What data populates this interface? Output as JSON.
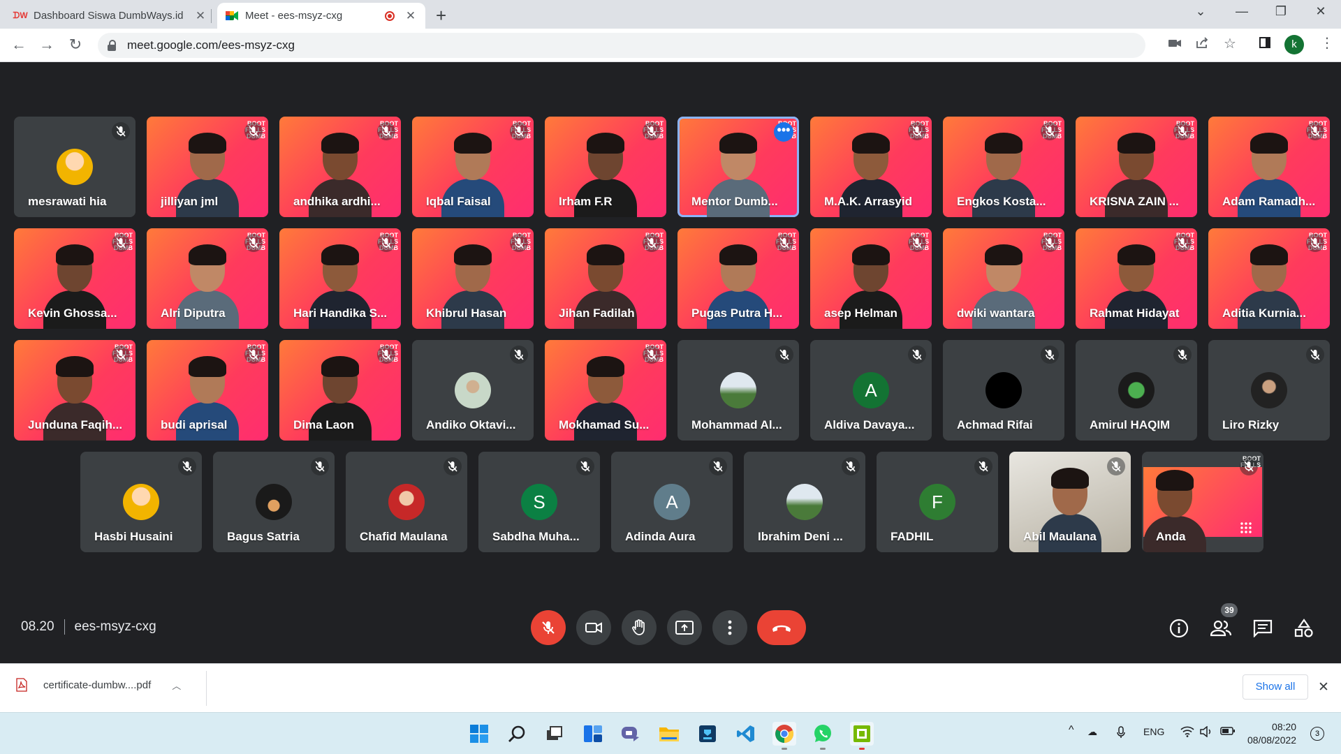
{
  "browser": {
    "tabs": [
      {
        "title": "Dashboard Siswa DumbWays.id",
        "favicon": "dumbways-logo"
      },
      {
        "title": "Meet - ees-msyz-cxg",
        "favicon": "google-meet-logo",
        "recording": true
      }
    ],
    "url": "meet.google.com/ees-msyz-cxg",
    "profile_initial": "k"
  },
  "meet": {
    "participants": [
      {
        "name": "mesrawati hia",
        "type": "avatar"
      },
      {
        "name": "jilliyan jml",
        "type": "video"
      },
      {
        "name": "andhika ardhi...",
        "type": "video"
      },
      {
        "name": "Iqbal Faisal",
        "type": "video"
      },
      {
        "name": "Irham F.R",
        "type": "video"
      },
      {
        "name": "Mentor Dumb...",
        "type": "video",
        "pinned": true
      },
      {
        "name": "M.A.K. Arrasyid",
        "type": "video"
      },
      {
        "name": "Engkos Kosta...",
        "type": "video"
      },
      {
        "name": "KRISNA ZAIN ...",
        "type": "video"
      },
      {
        "name": "Adam Ramadh...",
        "type": "video"
      },
      {
        "name": "Kevin Ghossa...",
        "type": "video"
      },
      {
        "name": "Alri Diputra",
        "type": "video"
      },
      {
        "name": "Hari Handika S...",
        "type": "video"
      },
      {
        "name": "Khibrul Hasan",
        "type": "video"
      },
      {
        "name": "Jihan Fadilah",
        "type": "video"
      },
      {
        "name": "Pugas Putra H...",
        "type": "video"
      },
      {
        "name": "asep Helman",
        "type": "video"
      },
      {
        "name": "dwiki wantara",
        "type": "video"
      },
      {
        "name": "Rahmat Hidayat",
        "type": "video"
      },
      {
        "name": "Aditia Kurnia...",
        "type": "video"
      },
      {
        "name": "Junduna Faqih...",
        "type": "video"
      },
      {
        "name": "budi aprisal",
        "type": "video"
      },
      {
        "name": "Dima Laon",
        "type": "video"
      },
      {
        "name": "Andiko Oktavi...",
        "type": "avatar"
      },
      {
        "name": "Mokhamad Su...",
        "type": "video"
      },
      {
        "name": "Mohammad Al...",
        "type": "avatar"
      },
      {
        "name": "Aldiva Davaya...",
        "type": "letter",
        "letter": "A",
        "color": "#137333"
      },
      {
        "name": "Achmad Rifai",
        "type": "avatar"
      },
      {
        "name": "Amirul HAQIM",
        "type": "avatar"
      },
      {
        "name": "Liro Rizky",
        "type": "avatar"
      },
      {
        "name": "Hasbi Husaini",
        "type": "avatar"
      },
      {
        "name": "Bagus Satria",
        "type": "avatar"
      },
      {
        "name": "Chafid Maulana",
        "type": "avatar"
      },
      {
        "name": "Sabdha Muha...",
        "type": "letter",
        "letter": "S",
        "color": "#0b8043"
      },
      {
        "name": "Adinda Aura",
        "type": "letter",
        "letter": "A",
        "color": "#607d8b"
      },
      {
        "name": "Ibrahim Deni ...",
        "type": "avatar"
      },
      {
        "name": "FADHIL",
        "type": "letter",
        "letter": "F",
        "color": "#2e7d32"
      },
      {
        "name": "Abil Maulana",
        "type": "camera"
      },
      {
        "name": "Anda",
        "type": "video",
        "self": true
      }
    ],
    "time": "08.20",
    "meeting_code": "ees-msyz-cxg",
    "participant_count": "39",
    "controls": [
      "mic-off-button",
      "camera-button",
      "raise-hand-button",
      "present-button",
      "more-options-button",
      "leave-call-button"
    ],
    "right_controls": [
      "info-button",
      "people-button",
      "chat-button",
      "activities-button"
    ]
  },
  "download": {
    "filename": "certificate-dumbw....pdf",
    "show_all_label": "Show all"
  },
  "taskbar": {
    "language": "ENG",
    "time": "08:20",
    "date": "08/08/2022",
    "notifications": "3"
  },
  "colors": {
    "meet_bg": "#202124",
    "tile_bg": "#3c4043",
    "end_call": "#ea4335",
    "accent": "#1a73e8"
  }
}
